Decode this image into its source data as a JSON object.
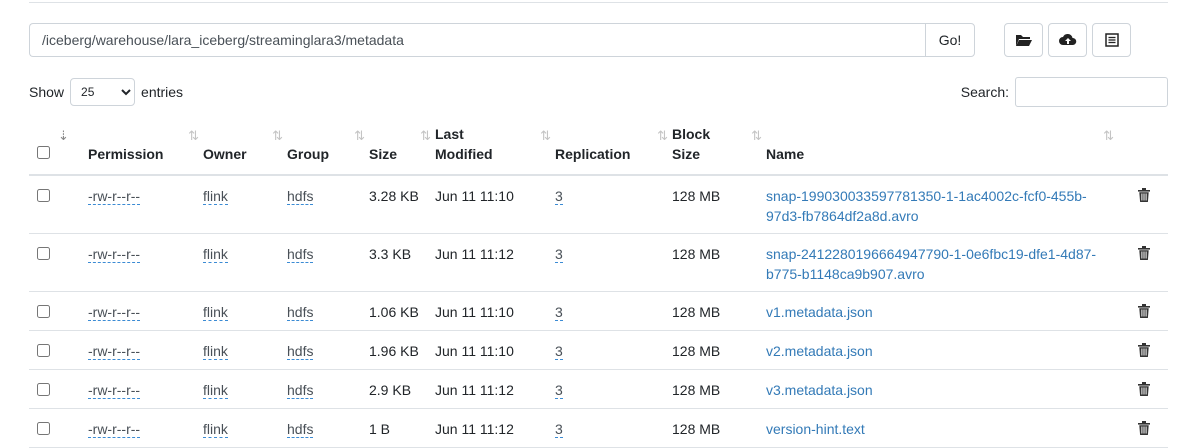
{
  "path": {
    "value": "/iceberg/warehouse/lara_iceberg/streaminglara3/metadata",
    "go_label": "Go!"
  },
  "toolbar": {
    "icons": [
      "folder-open-icon",
      "cloud-upload-icon",
      "list-icon"
    ]
  },
  "length": {
    "show_label": "Show",
    "selected": "25",
    "entries_label": "entries"
  },
  "search": {
    "label": "Search:",
    "value": ""
  },
  "table": {
    "headers": {
      "permission": "Permission",
      "owner": "Owner",
      "group": "Group",
      "size": "Size",
      "last": "Last",
      "modified": "Modified",
      "replication": "Replication",
      "block": "Block",
      "block_size": "Size",
      "name": "Name"
    },
    "rows": [
      {
        "permission": "-rw-r--r--",
        "owner": "flink",
        "group": "hdfs",
        "size": "3.28 KB",
        "modified": "Jun 11 11:10",
        "replication": "3",
        "block_size": "128 MB",
        "name": "snap-199030033597781350-1-1ac4002c-fcf0-455b-97d3-fb7864df2a8d.avro"
      },
      {
        "permission": "-rw-r--r--",
        "owner": "flink",
        "group": "hdfs",
        "size": "3.3 KB",
        "modified": "Jun 11 11:12",
        "replication": "3",
        "block_size": "128 MB",
        "name": "snap-2412280196664947790-1-0e6fbc19-dfe1-4d87-b775-b1148ca9b907.avro"
      },
      {
        "permission": "-rw-r--r--",
        "owner": "flink",
        "group": "hdfs",
        "size": "1.06 KB",
        "modified": "Jun 11 11:10",
        "replication": "3",
        "block_size": "128 MB",
        "name": "v1.metadata.json"
      },
      {
        "permission": "-rw-r--r--",
        "owner": "flink",
        "group": "hdfs",
        "size": "1.96 KB",
        "modified": "Jun 11 11:10",
        "replication": "3",
        "block_size": "128 MB",
        "name": "v2.metadata.json"
      },
      {
        "permission": "-rw-r--r--",
        "owner": "flink",
        "group": "hdfs",
        "size": "2.9 KB",
        "modified": "Jun 11 11:12",
        "replication": "3",
        "block_size": "128 MB",
        "name": "v3.metadata.json"
      },
      {
        "permission": "-rw-r--r--",
        "owner": "flink",
        "group": "hdfs",
        "size": "1 B",
        "modified": "Jun 11 11:12",
        "replication": "3",
        "block_size": "128 MB",
        "name": "version-hint.text"
      }
    ]
  }
}
